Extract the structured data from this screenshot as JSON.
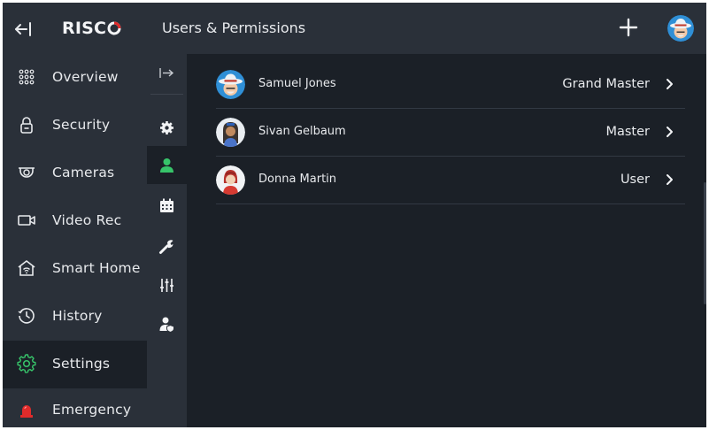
{
  "brand": {
    "logo_text": "RISC"
  },
  "header": {
    "title": "Users & Permissions"
  },
  "sidebar": {
    "items": [
      {
        "label": "Overview",
        "icon": "grid-dots-icon"
      },
      {
        "label": "Security",
        "icon": "padlock-icon"
      },
      {
        "label": "Cameras",
        "icon": "dome-camera-icon"
      },
      {
        "label": "Video Rec",
        "icon": "video-camera-icon"
      },
      {
        "label": "Smart Home",
        "icon": "smart-home-icon"
      },
      {
        "label": "History",
        "icon": "history-clock-icon"
      },
      {
        "label": "Settings",
        "icon": "gear-icon",
        "active": true
      },
      {
        "label": "Emergency",
        "icon": "siren-icon"
      }
    ]
  },
  "subnav": {
    "items": [
      {
        "icon": "expand-arrow-icon"
      },
      {
        "icon": "gear-icon"
      },
      {
        "icon": "user-icon",
        "active": true
      },
      {
        "icon": "calendar-icon"
      },
      {
        "icon": "wrench-icon"
      },
      {
        "icon": "sliders-icon"
      },
      {
        "icon": "user-shield-icon"
      }
    ]
  },
  "users": [
    {
      "name": "Samuel Jones",
      "role": "Grand Master",
      "avatar": "avatar-cowboy-hat"
    },
    {
      "name": "Sivan Gelbaum",
      "role": "Master",
      "avatar": "avatar-woman-dark-hair"
    },
    {
      "name": "Donna Martin",
      "role": "User",
      "avatar": "avatar-woman-red-hair"
    }
  ],
  "colors": {
    "background": "#1b2027",
    "panel": "#2a3039",
    "accent_green": "#37c46a",
    "accent_red": "#e02b2b",
    "text": "#e8eaed"
  }
}
